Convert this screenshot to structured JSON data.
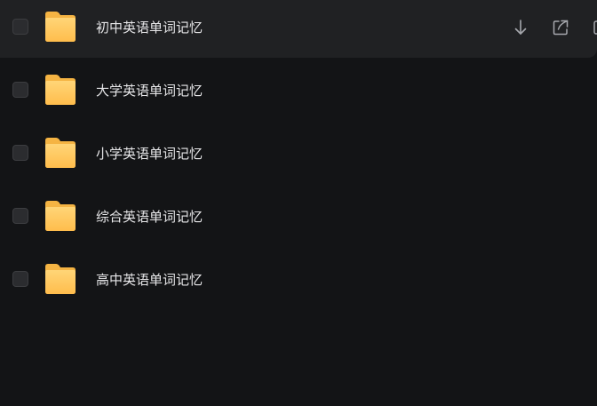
{
  "colors": {
    "background": "#131416",
    "row_hover": "#202123",
    "text": "#e6e6e8",
    "folder_top": "#ffd375",
    "folder_bottom": "#ffbf4f",
    "icon": "#a6a8ad"
  },
  "files": [
    {
      "name": "初中英语单词记忆",
      "type": "folder",
      "icon": "folder-icon",
      "hovered": true
    },
    {
      "name": "大学英语单词记忆",
      "type": "folder",
      "icon": "folder-icon",
      "hovered": false
    },
    {
      "name": "小学英语单词记忆",
      "type": "folder",
      "icon": "folder-icon",
      "hovered": false
    },
    {
      "name": "综合英语单词记忆",
      "type": "folder",
      "icon": "folder-icon",
      "hovered": false
    },
    {
      "name": "高中英语单词记忆",
      "type": "folder",
      "icon": "folder-icon",
      "hovered": false
    }
  ],
  "row_actions": [
    {
      "icon": "download-icon"
    },
    {
      "icon": "share-icon"
    },
    {
      "icon": "copy-icon"
    }
  ]
}
